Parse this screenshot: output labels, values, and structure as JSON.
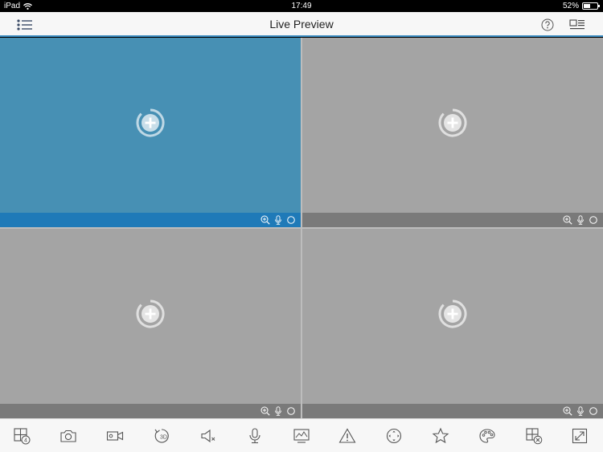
{
  "status_bar": {
    "carrier": "iPad",
    "time": "17:49",
    "battery": "52%",
    "battery_level": 0.52
  },
  "nav": {
    "title": "Live Preview",
    "menu_icon": "list-menu-icon",
    "help_icon": "help-circle-icon",
    "layout_icon": "window-layout-icon"
  },
  "grid": {
    "windows": [
      {
        "state": "selected",
        "add_icon": "add-camera-icon"
      },
      {
        "state": "empty",
        "add_icon": "add-camera-icon"
      },
      {
        "state": "empty",
        "add_icon": "add-camera-icon"
      },
      {
        "state": "empty",
        "add_icon": "add-camera-icon"
      }
    ],
    "window_tools": [
      "zoom-in-icon",
      "microphone-icon",
      "record-dot-icon"
    ]
  },
  "toolbar": {
    "items": [
      {
        "icon": "split-4-window-icon",
        "badge": "4"
      },
      {
        "icon": "camera-snapshot-icon"
      },
      {
        "icon": "video-record-icon"
      },
      {
        "icon": "3d-rotate-icon",
        "badge": "3D"
      },
      {
        "icon": "speaker-mute-icon"
      },
      {
        "icon": "microphone-icon"
      },
      {
        "icon": "quality-monitor-icon"
      },
      {
        "icon": "alarm-warning-icon"
      },
      {
        "icon": "ptz-control-icon"
      },
      {
        "icon": "favorites-star-icon"
      },
      {
        "icon": "color-palette-icon"
      },
      {
        "icon": "close-all-windows-icon"
      },
      {
        "icon": "fullscreen-icon"
      }
    ]
  },
  "colors": {
    "accent": "#3a8bbf",
    "selected_window": "#4790b4",
    "selected_bar": "#1f7ab8",
    "empty_window": "#a4a4a4",
    "window_bar": "#7a7a7a"
  }
}
